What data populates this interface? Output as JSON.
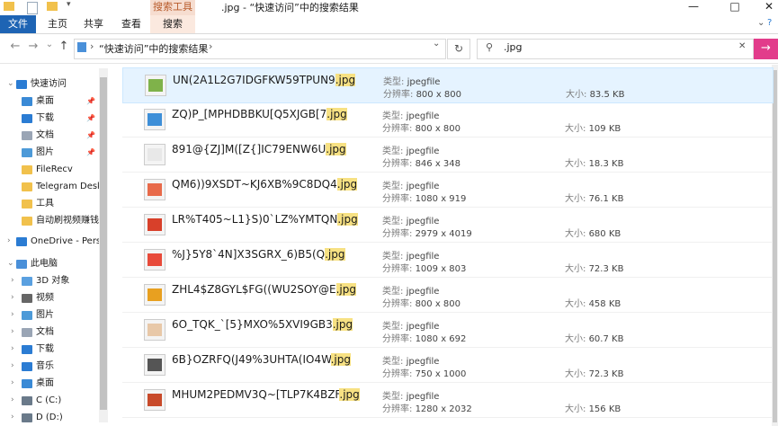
{
  "window": {
    "title": ".jpg - “快速访问”中的搜索结果",
    "minimize_glyph": "—",
    "maximize_glyph": "□",
    "close_glyph": "✕"
  },
  "ribbon": {
    "context_group": "搜索工具",
    "tabs": [
      "文件",
      "主页",
      "共享",
      "查看",
      "搜索"
    ]
  },
  "address": {
    "path": "“快速访问”中的搜索结果",
    "separator": "›",
    "dropdown_glyph": "⌄",
    "refresh_glyph": "↻"
  },
  "search": {
    "value": ".jpg",
    "clear_glyph": "✕",
    "go_glyph": "→"
  },
  "nav_glyphs": {
    "back": "←",
    "forward": "→",
    "recent": "⌄",
    "up": "↑"
  },
  "nav": [
    {
      "label": "快速访问",
      "icon": "star-icon",
      "color": "#2b7cd3",
      "expanded": true,
      "level": 0
    },
    {
      "label": "桌面",
      "icon": "desktop-folder-icon",
      "color": "#3a8ad6",
      "pinned": true,
      "level": 1
    },
    {
      "label": "下载",
      "icon": "download-folder-icon",
      "color": "#2b7cd3",
      "pinned": true,
      "level": 1
    },
    {
      "label": "文档",
      "icon": "documents-folder-icon",
      "color": "#9aa5b5",
      "pinned": true,
      "level": 1
    },
    {
      "label": "图片",
      "icon": "pictures-folder-icon",
      "color": "#4d9ad8",
      "pinned": true,
      "level": 1
    },
    {
      "label": "FileRecv",
      "icon": "folder-icon",
      "color": "#f1c14c",
      "level": 1
    },
    {
      "label": "Telegram Desk",
      "icon": "folder-icon",
      "color": "#f1c14c",
      "level": 1
    },
    {
      "label": "工具",
      "icon": "folder-icon",
      "color": "#f1c14c",
      "level": 1
    },
    {
      "label": "自动刷视频赚钱",
      "icon": "folder-icon",
      "color": "#f1c14c",
      "level": 1
    },
    {
      "label": "OneDrive - Perso",
      "icon": "cloud-icon",
      "color": "#2b7cd3",
      "level": 0
    },
    {
      "label": "此电脑",
      "icon": "computer-icon",
      "color": "#4a90d9",
      "expanded": true,
      "level": 0
    },
    {
      "label": "3D 对象",
      "icon": "3d-objects-icon",
      "color": "#5aa0e0",
      "level": 1
    },
    {
      "label": "视频",
      "icon": "videos-folder-icon",
      "color": "#666666",
      "level": 1
    },
    {
      "label": "图片",
      "icon": "pictures-folder-icon",
      "color": "#4d9ad8",
      "level": 1
    },
    {
      "label": "文档",
      "icon": "documents-folder-icon",
      "color": "#9aa5b5",
      "level": 1
    },
    {
      "label": "下载",
      "icon": "download-folder-icon",
      "color": "#2b7cd3",
      "level": 1
    },
    {
      "label": "音乐",
      "icon": "music-note-icon",
      "color": "#2b7cd3",
      "level": 1
    },
    {
      "label": "桌面",
      "icon": "desktop-folder-icon",
      "color": "#3a8ad6",
      "level": 1
    },
    {
      "label": "C (C:)",
      "icon": "drive-icon",
      "color": "#6a7a8a",
      "level": 1
    },
    {
      "label": "D (D:)",
      "icon": "drive-icon",
      "color": "#6a7a8a",
      "level": 1
    }
  ],
  "labels": {
    "type": "类型:",
    "resolution": "分辨率:",
    "size": "大小:"
  },
  "results": [
    {
      "name": "UN(2A1L2G7IDGFKW59TPUN9",
      "ext": ".jpg",
      "type": "jpegfile",
      "resolution": "800 x 800",
      "size": "83.5 KB",
      "selected": true,
      "thumb": "#7fb24a"
    },
    {
      "name": "ZQ)P_[MPHDBBKU[Q5XJGB[7",
      "ext": ".jpg",
      "type": "jpegfile",
      "resolution": "800 x 800",
      "size": "109 KB",
      "thumb": "#3e8fd8"
    },
    {
      "name": "891@{ZJ]M([Z{]IC79ENW6U",
      "ext": ".jpg",
      "type": "jpegfile",
      "resolution": "846 x 348",
      "size": "18.3 KB",
      "thumb": "#e8e8e8"
    },
    {
      "name": "QM6))9XSDT~KJ6XB%9C8DQ4",
      "ext": ".jpg",
      "type": "jpegfile",
      "resolution": "1080 x 919",
      "size": "76.1 KB",
      "thumb": "#e86a4a"
    },
    {
      "name": "LR%T405~L1}S)0`LZ%YMTQN",
      "ext": ".jpg",
      "type": "jpegfile",
      "resolution": "2979 x 4019",
      "size": "680 KB",
      "thumb": "#d8402a"
    },
    {
      "name": "%J}5Y8`4N]X3SGRX_6)B5(Q",
      "ext": ".jpg",
      "type": "jpegfile",
      "resolution": "1009 x 803",
      "size": "72.3 KB",
      "thumb": "#e84a3a"
    },
    {
      "name": "ZHL4$Z8GYL$FG((WU2SOY@E",
      "ext": ".jpg",
      "type": "jpegfile",
      "resolution": "800 x 800",
      "size": "458 KB",
      "thumb": "#e8a020"
    },
    {
      "name": "6O_TQK_`[5}MXO%5XVI9GB3",
      "ext": ".jpg",
      "type": "jpegfile",
      "resolution": "1080 x 692",
      "size": "60.7 KB",
      "thumb": "#e8c8a8"
    },
    {
      "name": "6B}OZRFQ(J49%3UHTA(IO4W",
      "ext": ".jpg",
      "type": "jpegfile",
      "resolution": "750 x 1000",
      "size": "72.3 KB",
      "thumb": "#555555"
    },
    {
      "name": "MHUM2PEDMV3Q~[TLP7K4BZF",
      "ext": ".jpg",
      "type": "jpegfile",
      "resolution": "1280 x 2032",
      "size": "156 KB",
      "thumb": "#c84a2a"
    }
  ]
}
